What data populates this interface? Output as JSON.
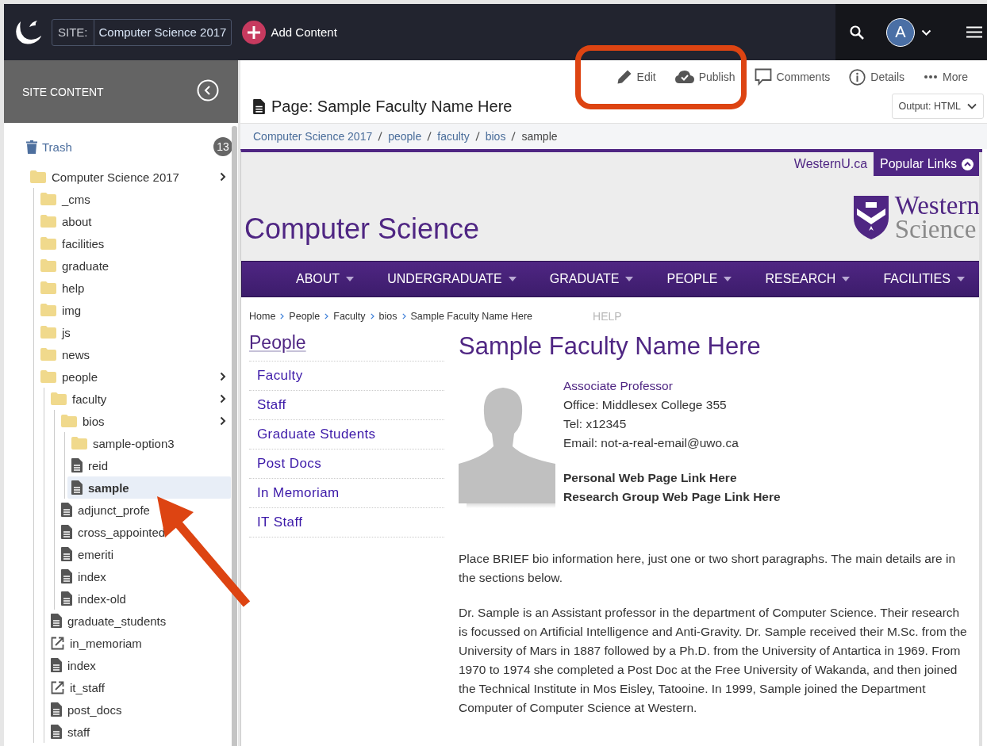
{
  "topbar": {
    "site_label": "SITE:",
    "site_name": "Computer Science 2017",
    "add_label": "Add Content",
    "avatar_letter": "A"
  },
  "sidebar": {
    "title": "SITE CONTENT",
    "trash": {
      "label": "Trash",
      "count": "13"
    },
    "tree": [
      {
        "label": "Computer Science 2017",
        "kind": "folder",
        "selected": false,
        "children": [
          {
            "label": "_cms",
            "kind": "folder",
            "selected": false
          },
          {
            "label": "about",
            "kind": "folder",
            "selected": false
          },
          {
            "label": "facilities",
            "kind": "folder",
            "selected": false
          },
          {
            "label": "graduate",
            "kind": "folder",
            "selected": false
          },
          {
            "label": "help",
            "kind": "folder",
            "selected": false
          },
          {
            "label": "img",
            "kind": "folder",
            "selected": false
          },
          {
            "label": "js",
            "kind": "folder",
            "selected": false
          },
          {
            "label": "news",
            "kind": "folder",
            "selected": false
          },
          {
            "label": "people",
            "kind": "folder",
            "selected": false,
            "children": [
              {
                "label": "faculty",
                "kind": "folder",
                "selected": false,
                "children": [
                  {
                    "label": "bios",
                    "kind": "folder",
                    "selected": false,
                    "children": [
                      {
                        "label": "sample-option3",
                        "kind": "folder",
                        "selected": false
                      },
                      {
                        "label": "reid",
                        "kind": "page",
                        "selected": false
                      },
                      {
                        "label": "sample",
                        "kind": "page",
                        "selected": true
                      }
                    ]
                  },
                  {
                    "label": "adjunct_profe",
                    "kind": "page",
                    "selected": false
                  },
                  {
                    "label": "cross_appointed",
                    "kind": "page",
                    "selected": false
                  },
                  {
                    "label": "emeriti",
                    "kind": "page",
                    "selected": false
                  },
                  {
                    "label": "index",
                    "kind": "page",
                    "selected": false
                  },
                  {
                    "label": "index-old",
                    "kind": "page",
                    "selected": false
                  }
                ]
              },
              {
                "label": "graduate_students",
                "kind": "page",
                "selected": false
              },
              {
                "label": "in_memoriam",
                "kind": "link",
                "selected": false
              },
              {
                "label": "index",
                "kind": "page",
                "selected": false
              },
              {
                "label": "it_staff",
                "kind": "link",
                "selected": false
              },
              {
                "label": "post_docs",
                "kind": "page",
                "selected": false
              },
              {
                "label": "staff",
                "kind": "page",
                "selected": false
              }
            ]
          }
        ]
      }
    ]
  },
  "toolbar": {
    "actions": [
      {
        "kind": "edit",
        "label": "Edit"
      },
      {
        "kind": "publish",
        "label": "Publish"
      },
      {
        "kind": "comments",
        "label": "Comments"
      },
      {
        "kind": "details",
        "label": "Details"
      },
      {
        "kind": "more",
        "label": "More"
      }
    ],
    "page_title": "Page: Sample Faculty Name Here",
    "output": "Output: HTML"
  },
  "breadcrumb": [
    {
      "label": "Computer Science 2017",
      "link": true
    },
    {
      "label": "people",
      "link": true
    },
    {
      "label": "faculty",
      "link": true
    },
    {
      "label": "bios",
      "link": true
    },
    {
      "label": "sample",
      "link": false
    }
  ],
  "preview": {
    "top_link": "WesternU.ca",
    "popular_button": "Popular Links",
    "site_title": "Computer Science",
    "logo": {
      "line1": "Western",
      "line2": "Science"
    },
    "nav": [
      "ABOUT",
      "UNDERGRADUATE",
      "GRADUATE",
      "PEOPLE",
      "RESEARCH",
      "FACILITIES"
    ],
    "crumbs": [
      "Home",
      "People",
      "Faculty",
      "bios",
      "Sample Faculty Name Here"
    ],
    "ghost_text": "HELP",
    "side_nav": {
      "heading": "People",
      "items": [
        "Faculty",
        "Staff",
        "Graduate Students",
        "Post Docs",
        "In Memoriam",
        "IT Staff"
      ]
    },
    "profile": {
      "name": "Sample Faculty Name Here",
      "title": "Associate Professor",
      "details": [
        "Office: Middlesex College 355",
        "Tel: x12345",
        "Email: not-a-real-email@uwo.ca"
      ],
      "links": [
        "Personal Web Page Link Here",
        "Research Group Web Page Link Here"
      ]
    },
    "bio": [
      "Place BRIEF bio information here, just one or two short paragraphs. The main details are in the sections below.",
      "Dr. Sample is an Assistant professor in the department of Computer Science. Their research is focussed on Artificial Intelligence and Anti-Gravity. Dr. Sample received their M.Sc. from the University of Mars in 1887 followed by a Ph.D. from the University of Antartica in 1969. From 1970 to 1974 she completed a Post Doc at the Free University of Wakanda, and then joined the Technical Institute in Mos Eisley, Tatooine. In 1999, Sample joined the Department Computer of Computer Science at Western."
    ]
  }
}
